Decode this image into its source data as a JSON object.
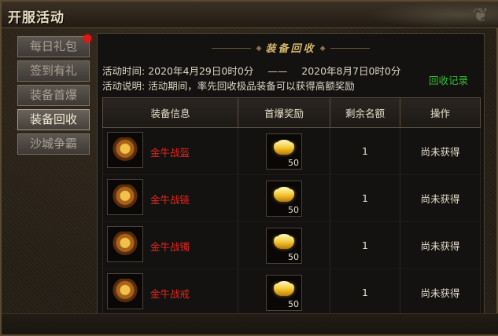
{
  "window": {
    "title": "开服活动",
    "close_icon": "close-icon"
  },
  "tabs": [
    {
      "label": "每日礼包",
      "active": false,
      "badge": true
    },
    {
      "label": "签到有礼",
      "active": false,
      "badge": false
    },
    {
      "label": "装备首爆",
      "active": false,
      "badge": false
    },
    {
      "label": "装备回收",
      "active": true,
      "badge": false
    },
    {
      "label": "沙城争霸",
      "active": false,
      "badge": false
    }
  ],
  "panel": {
    "title": "装备回收",
    "time_label": "活动时间:",
    "time_start": "2020年4月29日0时0分",
    "time_sep": "——",
    "time_end": "2020年8月7日0时0分",
    "desc_label": "活动说明:",
    "desc_text": "活动期间，率先回收极品装备可以获得高额奖励",
    "record_link": "回收记录"
  },
  "table": {
    "headers": [
      "装备信息",
      "首爆奖励",
      "剩余名额",
      "操作"
    ],
    "rows": [
      {
        "name": "金牛战盔",
        "reward_qty": "50",
        "remaining": "1",
        "status": "尚未获得",
        "icon": "helmet-icon"
      },
      {
        "name": "金牛战链",
        "reward_qty": "50",
        "remaining": "1",
        "status": "尚未获得",
        "icon": "necklace-icon"
      },
      {
        "name": "金牛战镯",
        "reward_qty": "50",
        "remaining": "1",
        "status": "尚未获得",
        "icon": "bracelet-icon"
      },
      {
        "name": "金牛战戒",
        "reward_qty": "50",
        "remaining": "1",
        "status": "尚未获得",
        "icon": "ring-icon"
      }
    ]
  },
  "colors": {
    "item_name": "#e0261e",
    "record_link": "#2ec52e",
    "title_gold": "#d8b76a",
    "badge": "#e01a10"
  }
}
